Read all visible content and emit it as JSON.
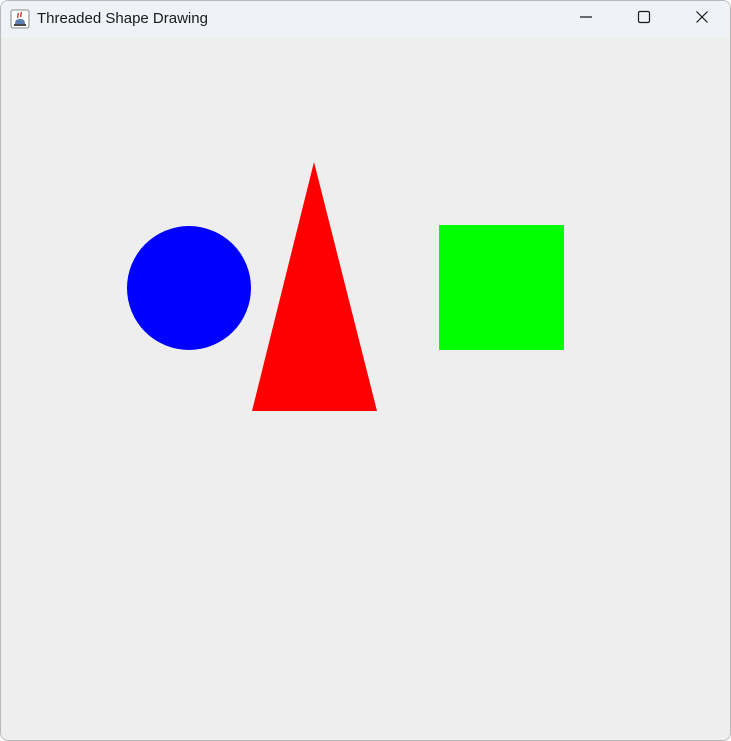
{
  "window": {
    "title": "Threaded Shape Drawing",
    "app_icon": "java-cup-icon",
    "controls": {
      "minimize_icon": "minimize-icon",
      "maximize_icon": "maximize-icon",
      "close_icon": "close-icon"
    }
  },
  "canvas": {
    "background": "#eeeeee",
    "shapes": [
      {
        "kind": "circle",
        "color": "#0000ff"
      },
      {
        "kind": "triangle",
        "color": "#ff0000"
      },
      {
        "kind": "square",
        "color": "#00ff00"
      }
    ]
  }
}
